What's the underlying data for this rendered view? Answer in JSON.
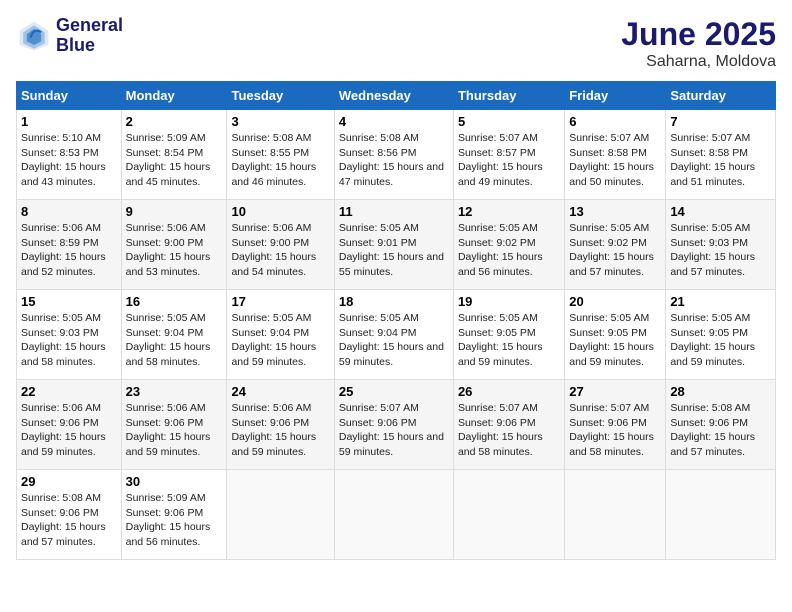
{
  "logo": {
    "line1": "General",
    "line2": "Blue"
  },
  "title": "June 2025",
  "subtitle": "Saharna, Moldova",
  "days_header": [
    "Sunday",
    "Monday",
    "Tuesday",
    "Wednesday",
    "Thursday",
    "Friday",
    "Saturday"
  ],
  "weeks": [
    [
      {
        "day": "1",
        "sunrise": "5:10 AM",
        "sunset": "8:53 PM",
        "daylight": "15 hours and 43 minutes."
      },
      {
        "day": "2",
        "sunrise": "5:09 AM",
        "sunset": "8:54 PM",
        "daylight": "15 hours and 45 minutes."
      },
      {
        "day": "3",
        "sunrise": "5:08 AM",
        "sunset": "8:55 PM",
        "daylight": "15 hours and 46 minutes."
      },
      {
        "day": "4",
        "sunrise": "5:08 AM",
        "sunset": "8:56 PM",
        "daylight": "15 hours and 47 minutes."
      },
      {
        "day": "5",
        "sunrise": "5:07 AM",
        "sunset": "8:57 PM",
        "daylight": "15 hours and 49 minutes."
      },
      {
        "day": "6",
        "sunrise": "5:07 AM",
        "sunset": "8:58 PM",
        "daylight": "15 hours and 50 minutes."
      },
      {
        "day": "7",
        "sunrise": "5:07 AM",
        "sunset": "8:58 PM",
        "daylight": "15 hours and 51 minutes."
      }
    ],
    [
      {
        "day": "8",
        "sunrise": "5:06 AM",
        "sunset": "8:59 PM",
        "daylight": "15 hours and 52 minutes."
      },
      {
        "day": "9",
        "sunrise": "5:06 AM",
        "sunset": "9:00 PM",
        "daylight": "15 hours and 53 minutes."
      },
      {
        "day": "10",
        "sunrise": "5:06 AM",
        "sunset": "9:00 PM",
        "daylight": "15 hours and 54 minutes."
      },
      {
        "day": "11",
        "sunrise": "5:05 AM",
        "sunset": "9:01 PM",
        "daylight": "15 hours and 55 minutes."
      },
      {
        "day": "12",
        "sunrise": "5:05 AM",
        "sunset": "9:02 PM",
        "daylight": "15 hours and 56 minutes."
      },
      {
        "day": "13",
        "sunrise": "5:05 AM",
        "sunset": "9:02 PM",
        "daylight": "15 hours and 57 minutes."
      },
      {
        "day": "14",
        "sunrise": "5:05 AM",
        "sunset": "9:03 PM",
        "daylight": "15 hours and 57 minutes."
      }
    ],
    [
      {
        "day": "15",
        "sunrise": "5:05 AM",
        "sunset": "9:03 PM",
        "daylight": "15 hours and 58 minutes."
      },
      {
        "day": "16",
        "sunrise": "5:05 AM",
        "sunset": "9:04 PM",
        "daylight": "15 hours and 58 minutes."
      },
      {
        "day": "17",
        "sunrise": "5:05 AM",
        "sunset": "9:04 PM",
        "daylight": "15 hours and 59 minutes."
      },
      {
        "day": "18",
        "sunrise": "5:05 AM",
        "sunset": "9:04 PM",
        "daylight": "15 hours and 59 minutes."
      },
      {
        "day": "19",
        "sunrise": "5:05 AM",
        "sunset": "9:05 PM",
        "daylight": "15 hours and 59 minutes."
      },
      {
        "day": "20",
        "sunrise": "5:05 AM",
        "sunset": "9:05 PM",
        "daylight": "15 hours and 59 minutes."
      },
      {
        "day": "21",
        "sunrise": "5:05 AM",
        "sunset": "9:05 PM",
        "daylight": "15 hours and 59 minutes."
      }
    ],
    [
      {
        "day": "22",
        "sunrise": "5:06 AM",
        "sunset": "9:06 PM",
        "daylight": "15 hours and 59 minutes."
      },
      {
        "day": "23",
        "sunrise": "5:06 AM",
        "sunset": "9:06 PM",
        "daylight": "15 hours and 59 minutes."
      },
      {
        "day": "24",
        "sunrise": "5:06 AM",
        "sunset": "9:06 PM",
        "daylight": "15 hours and 59 minutes."
      },
      {
        "day": "25",
        "sunrise": "5:07 AM",
        "sunset": "9:06 PM",
        "daylight": "15 hours and 59 minutes."
      },
      {
        "day": "26",
        "sunrise": "5:07 AM",
        "sunset": "9:06 PM",
        "daylight": "15 hours and 58 minutes."
      },
      {
        "day": "27",
        "sunrise": "5:07 AM",
        "sunset": "9:06 PM",
        "daylight": "15 hours and 58 minutes."
      },
      {
        "day": "28",
        "sunrise": "5:08 AM",
        "sunset": "9:06 PM",
        "daylight": "15 hours and 57 minutes."
      }
    ],
    [
      {
        "day": "29",
        "sunrise": "5:08 AM",
        "sunset": "9:06 PM",
        "daylight": "15 hours and 57 minutes."
      },
      {
        "day": "30",
        "sunrise": "5:09 AM",
        "sunset": "9:06 PM",
        "daylight": "15 hours and 56 minutes."
      },
      null,
      null,
      null,
      null,
      null
    ]
  ]
}
